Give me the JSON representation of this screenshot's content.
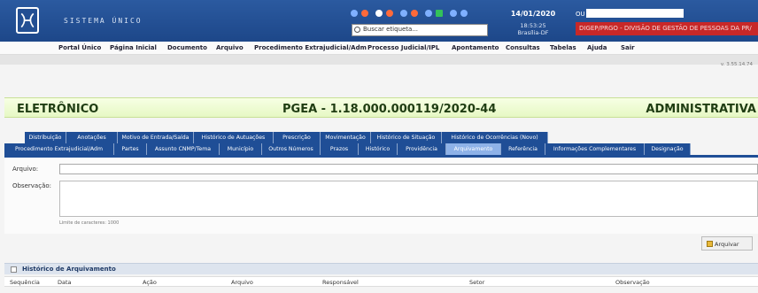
{
  "header": {
    "system_name": "SISTEMA ÚNICO",
    "search_placeholder": "Buscar etiqueta...",
    "date": "14/01/2020",
    "time": "18:53:25 Brasília-DF",
    "user_label": "OU",
    "unit": "DIGEP/PRGO - DIVISÃO DE GESTÃO DE PESSOAS DA PR/",
    "colors": {
      "header": "#1d4789",
      "unit_bg": "#c82828"
    }
  },
  "menu": {
    "items": [
      "Portal Único",
      "Página Inicial",
      "Documento",
      "Arquivo",
      "Procedimento Extrajudicial/Adm",
      "Processo Judicial/IPL",
      "Apontamento",
      "Consultas",
      "Tabelas",
      "Ajuda",
      "Sair"
    ]
  },
  "version": "v. 3.55.14.74",
  "process": {
    "type": "ELETRÔNICO",
    "number": "PGEA - 1.18.000.000119/2020-44",
    "category": "ADMINISTRATIVA"
  },
  "tabs_row1": [
    "Distribuição",
    "Anotações",
    "Motivo de Entrada/Saída",
    "Histórico de Autuações",
    "Prescrição",
    "Movimentação",
    "Histórico de Situação",
    "Histórico de Ocorrências (Novo)"
  ],
  "tabs_row2": [
    "Procedimento Extrajudicial/Adm",
    "Partes",
    "Assunto CNMP/Tema",
    "Município",
    "Outros Números",
    "Prazos",
    "Histórico",
    "Providência",
    "Arquivamento",
    "Referência",
    "Informações Complementares",
    "Designação"
  ],
  "active_tab": "Arquivamento",
  "form": {
    "file_label": "Arquivo:",
    "file_value": "",
    "obs_label": "Observação:",
    "obs_value": "",
    "limit_text": "Limite de caracteres: 1000",
    "button": "Arquivar"
  },
  "history": {
    "title": "Histórico de Arquivamento",
    "columns": [
      "Sequência",
      "Data",
      "Ação",
      "Arquivo",
      "Responsável",
      "Setor",
      "Observação"
    ]
  }
}
